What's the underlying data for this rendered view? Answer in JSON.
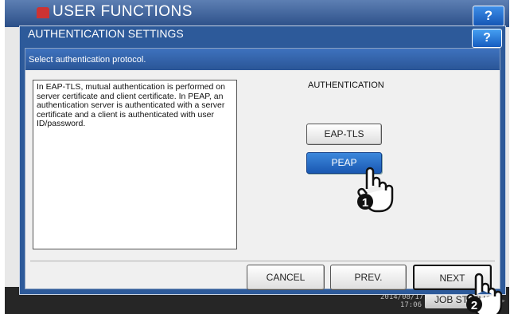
{
  "background_screen": {
    "title": "USER FUNCTIONS",
    "help_label": "?",
    "clock_date": "2014/08/17",
    "clock_time": "17:06",
    "job_status_label": "JOB STATUS"
  },
  "dialog": {
    "title": "AUTHENTICATION SETTINGS",
    "help_label": "?",
    "instruction": "Select authentication protocol.",
    "description": "In EAP-TLS, mutual authentication is performed on server certificate and client certificate. In PEAP, an authentication server is authenticated with a server certificate and a client is authenticated with user ID/password.",
    "authentication": {
      "heading": "AUTHENTICATION",
      "options": [
        {
          "label": "EAP-TLS",
          "selected": false
        },
        {
          "label": "PEAP",
          "selected": true
        }
      ]
    },
    "buttons": {
      "cancel": "CANCEL",
      "prev": "PREV.",
      "next": "NEXT"
    }
  },
  "callouts": [
    {
      "number": "1",
      "icon": "pointing-hand-icon"
    },
    {
      "number": "2",
      "icon": "pointing-hand-icon"
    }
  ],
  "colors": {
    "dialog_frame": "#2d5a9a",
    "selected_button": "#1a58b2",
    "help_button": "#1556b5"
  }
}
